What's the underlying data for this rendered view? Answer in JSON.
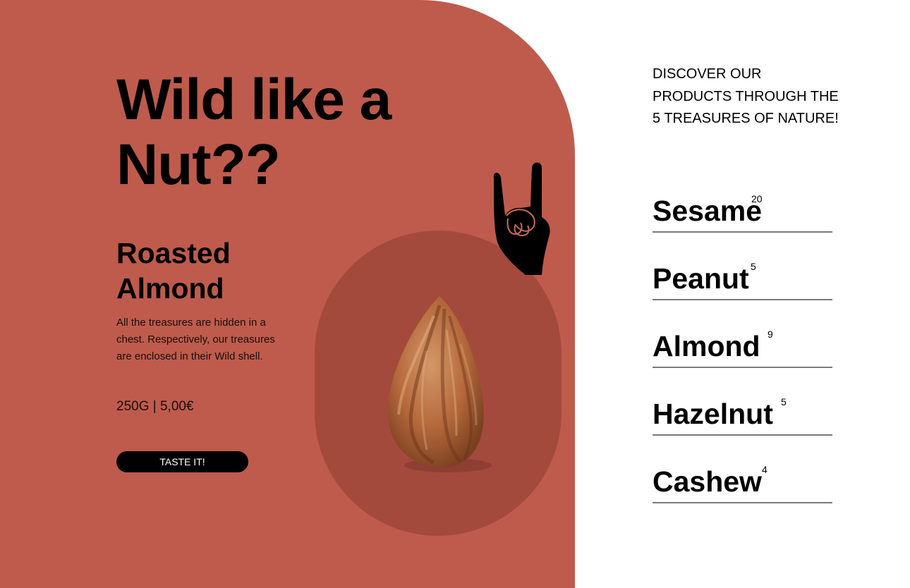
{
  "hero": {
    "headline": "Wild like a Nut??",
    "background_color": "#be5b4c",
    "oval_color": "#a44a3d"
  },
  "product": {
    "name": "Roasted Almond",
    "description": "All the treasures are hidden in a chest. Respectively, our treasures are enclosed in their Wild shell.",
    "price": "250G | 5,00€",
    "cta_label": "TASTE IT!",
    "image_icon": "almond-icon",
    "sticker_icon": "rock-hand-icon"
  },
  "sidebar": {
    "tagline": "DISCOVER OUR PRODUCTS THROUGH THE 5 TREASURES OF NATURE!",
    "nuts": [
      {
        "name": "Sesame",
        "count": "20"
      },
      {
        "name": "Peanut",
        "count": "5"
      },
      {
        "name": "Almond",
        "count": "9"
      },
      {
        "name": "Hazelnut",
        "count": "5"
      },
      {
        "name": "Cashew",
        "count": "4"
      }
    ]
  }
}
